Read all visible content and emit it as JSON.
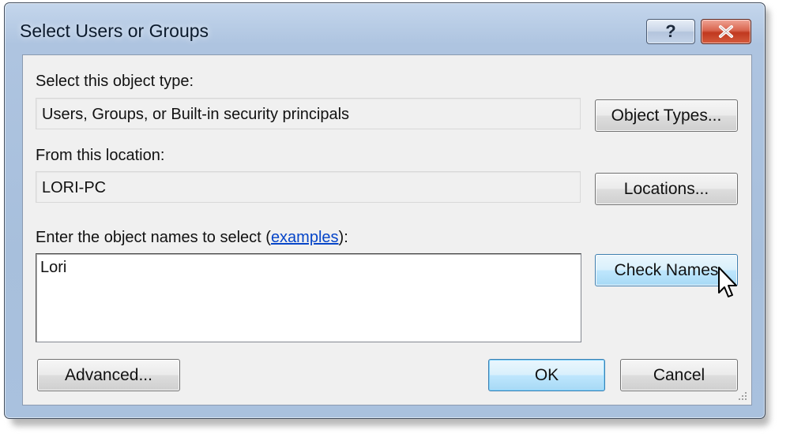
{
  "window": {
    "title": "Select Users or Groups",
    "help_label": "?"
  },
  "object_type": {
    "label": "Select this object type:",
    "value": "Users, Groups, or Built-in security principals",
    "button_label": "Object Types..."
  },
  "location": {
    "label": "From this location:",
    "value": "LORI-PC",
    "button_label": "Locations..."
  },
  "names": {
    "label_prefix": "Enter the object names to select (",
    "link_text": "examples",
    "label_suffix": "):",
    "value": "Lori",
    "check_names_label": "Check Names"
  },
  "footer": {
    "advanced_label": "Advanced...",
    "ok_label": "OK",
    "cancel_label": "Cancel"
  },
  "colors": {
    "title_frame": "#a7bfdc",
    "close_button": "#c0391f",
    "link": "#0645c8",
    "hover_button": "#bee6fd"
  }
}
